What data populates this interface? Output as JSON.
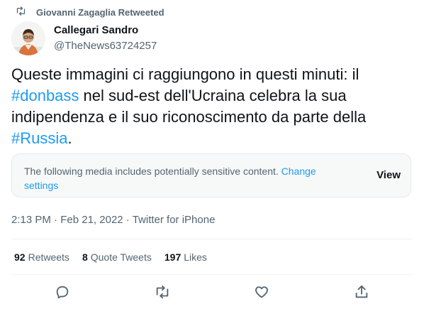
{
  "retweet_banner": {
    "text": "Giovanni Zagaglia Retweeted",
    "icon": "retweet-icon"
  },
  "author": {
    "name": "Callegari Sandro",
    "handle": "@TheNews63724257"
  },
  "tweet": {
    "segments": [
      {
        "text": "Queste immagini ci raggiungono in questi minuti: il ",
        "hashtag": false
      },
      {
        "text": "#donbass",
        "hashtag": true
      },
      {
        "text": " nel sud-est dell'Ucraina celebra la sua indipendenza e il suo riconoscimento da parte della ",
        "hashtag": false
      },
      {
        "text": "#Russia",
        "hashtag": true
      },
      {
        "text": ".",
        "hashtag": false
      }
    ]
  },
  "sensitive_notice": {
    "text": "The following media includes potentially sensitive content.",
    "link_label": "Change settings",
    "view_label": "View"
  },
  "meta": {
    "time": "2:13 PM",
    "separator": "·",
    "date": "Feb 21, 2022",
    "source": "Twitter for iPhone"
  },
  "stats": [
    {
      "count": "92",
      "label": "Retweets"
    },
    {
      "count": "8",
      "label": "Quote Tweets"
    },
    {
      "count": "197",
      "label": "Likes"
    }
  ],
  "actions": [
    "reply-icon",
    "retweet-icon",
    "like-icon",
    "share-icon"
  ],
  "colors": {
    "accent": "#1d9bf0",
    "secondary_text": "#536471",
    "primary_text": "#0f1419",
    "notice_bg": "#f7f9f9"
  }
}
